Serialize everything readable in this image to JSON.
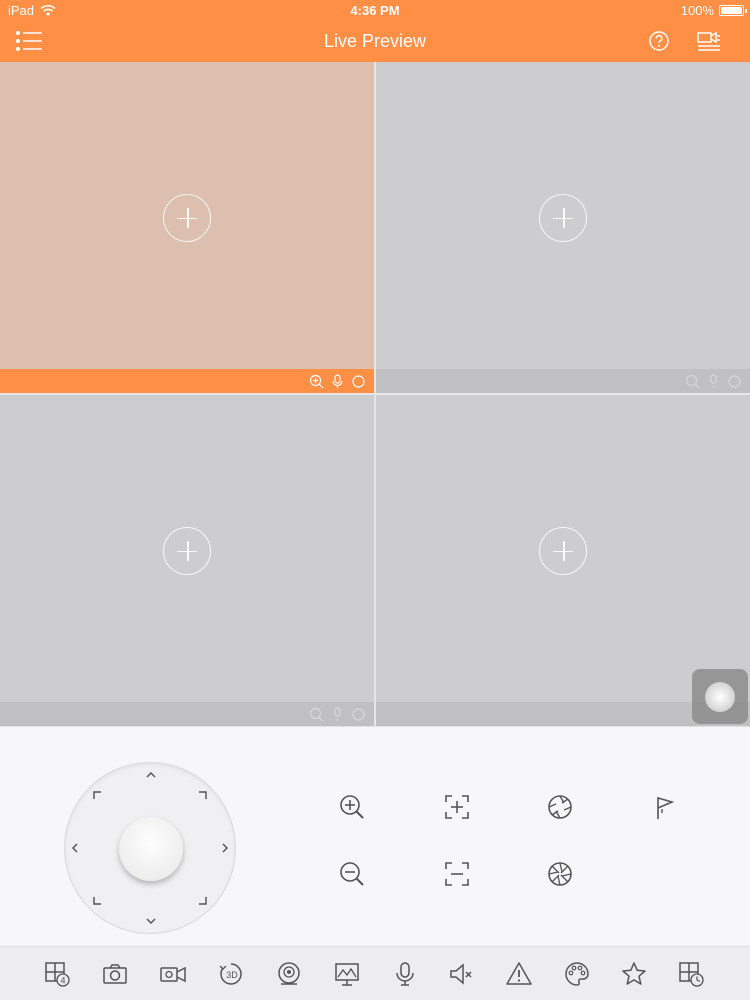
{
  "status_bar": {
    "device": "iPad",
    "time": "4:36 PM",
    "battery": "100%"
  },
  "nav": {
    "title": "Live Preview"
  },
  "colors": {
    "accent": "#ff8f45",
    "pane": "#cdcdcf",
    "active_pane": "#ddbfaf",
    "icon": "#555555"
  },
  "panes": [
    {
      "id": "window-1",
      "active": true,
      "tools": [
        "zoom-in-icon",
        "microphone-icon",
        "record-circle-icon"
      ]
    },
    {
      "id": "window-2",
      "active": false,
      "tools": [
        "zoom-in-icon",
        "microphone-icon",
        "record-circle-icon"
      ]
    },
    {
      "id": "window-3",
      "active": false,
      "tools": [
        "zoom-in-icon",
        "microphone-icon",
        "record-circle-icon"
      ]
    },
    {
      "id": "window-4",
      "active": false,
      "tools": []
    }
  ],
  "ptz_controls": [
    "zoom-in-icon",
    "focus-near-icon",
    "iris-open-icon",
    "preset-flag-icon",
    "zoom-out-icon",
    "focus-far-icon",
    "iris-close-icon"
  ],
  "toolbar": {
    "layout_count": "4",
    "rotate_label": "3D",
    "items": [
      "split-screen-icon",
      "snapshot-icon",
      "record-icon",
      "3d-positioning-icon",
      "fisheye-icon",
      "image-adjust-icon",
      "microphone-icon",
      "mute-icon",
      "alarm-icon",
      "color-palette-icon",
      "favorite-star-icon",
      "playback-icon"
    ]
  }
}
